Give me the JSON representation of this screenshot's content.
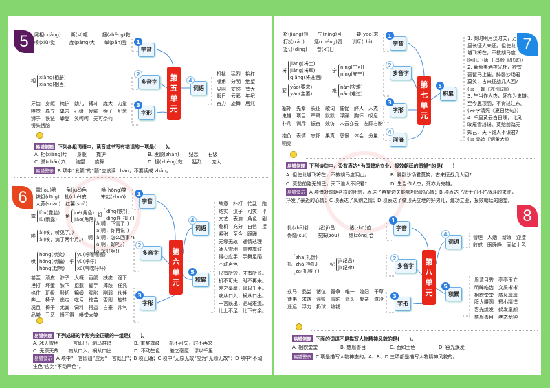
{
  "branches": {
    "ziyin": "字音",
    "duoyin": "多音字",
    "zixing": "字形",
    "ciyu": "词语",
    "jilei": "积累"
  },
  "nums": [
    "1",
    "2",
    "3",
    "4",
    "5"
  ],
  "quiz_labels": {
    "question": "易错例题",
    "answer": "易错警示"
  },
  "colors": {
    "unit5": "#5b1a5e",
    "unit6": "#e8461e",
    "unit7": "#1e8ae6",
    "unit8": "#e8304e",
    "center": "#e8271a",
    "background": "#86d66f"
  },
  "unit5": {
    "badge": "5",
    "center": [
      "第",
      "五",
      "单",
      "元"
    ],
    "ziyin": [
      "照相(xiàng)　　嘶(sī)哑　　　拯(zhěng)救",
      "嗅(xiù)觉　　　庞(páng)大　　攀(pān)登"
    ],
    "duoyin": [
      {
        "char": "相",
        "items": [
          "xiàng(相册)",
          "xiāng(相当)"
        ]
      }
    ],
    "zixing": [
      "牙齿　身躯　掩护　幼儿　搏斗　庞大　力量",
      "嗅觉　矗立　巢穴　石级　发颤　猴子　纪念",
      "狮子　铁链　攀登　笑呵呵　无可奈何",
      "愣头愣脑"
    ],
    "ciyu": [
      "打扰　猛烈　抬杠",
      "嘴角　分明　绝望",
      "尖叫　安然　夸大",
      "假日　云彩　年纪",
      "奋力　旋舞　居然"
    ],
    "quiz": {
      "question": "下列各组词语中，读音或书写有错误的一项是(　　)。",
      "options": [
        "A. 相(xiàng)片　　身躯　　掩护",
        "B. 发颤(zhàn)　　纪念　　石级",
        "C. 巢(cháo)穴　　绝望　　旋舞",
        "D. 拯(zhěng)救　　猛烈　　庞大"
      ],
      "answer": "B 项中“发颤”的“颤”应该读 chàn，不要读成 zhàn。"
    }
  },
  "unit6": {
    "badge": "6",
    "center": [
      "第",
      "六",
      "单",
      "元"
    ],
    "ziyin": [
      "露(lòu)脸　　角(jué)色　　　哄(hōng)笑",
      "铁钉(dīng)　扯(chě)皮　　　笨拙(zhuō)",
      "大蒜(suàn)　红薯(shǔ)"
    ],
    "duoyin": [
      {
        "char": "露",
        "items": [
          "lòu(露脸)",
          "lù(雨露)"
        ]
      },
      {
        "char": "角",
        "items": [
          "jué(角色)",
          "jiǎo(角落)"
        ]
      },
      {
        "char": "钉",
        "items": [
          "dīng(铁钉)",
          "dìng(钉扣子)"
        ]
      },
      {
        "char": "唉",
        "items": [
          "āi(唉，听见了。)",
          "ài(唉，病了两个月。)"
        ]
      },
      {
        "char": "啊",
        "items": [
          "ā(啊，下雪了!)",
          "á(啊，你再说!)",
          "ǎ(啊，怎么回事?)",
          "à(啊，好吧。)",
          "a(您好啊!)"
        ]
      },
      {
        "char": "哄",
        "items": [
          "hōng(哄笑)",
          "hǒng(哄骗)",
          "hòng(起哄)"
        ]
      },
      {
        "char": "吁",
        "items": [
          "yū(吁喔喔喔)",
          "yù(呼吁)",
          "xū(气喘吁吁)"
        ]
      }
    ],
    "zixing": [
      "甚至　顽皮　脖子　大概　香肠　扶携　跪下",
      "捶打　坏蛋　膝下　招惹　握手　摔跤　任凭",
      "掐住　班级　殷切　锦缎　膨胀　削弱　伙伴",
      "奔上　椅子　逃走　吃亏　挖苦　否则　旋转",
      "况且　椅子　尤其　饲料　得益　自豪　帅气",
      "品尝　丑恶　恨不得　哄堂大笑"
    ],
    "ciyu": [
      "故意　扑打　忙乱　跑",
      "结实　汉子　可笑　平",
      "文艺　表演　角色　剧",
      "危机　充分　自信　接",
      "紧张　至今　蹒跚",
      "无缘无故　通情达理",
      "冰天雪地　重整旗鼓",
      "得心应手　手舞足蹈",
      "不动声色"
    ],
    "jilei": [
      "尺有所短，寸有所长。",
      "机不可失，时不再来。",
      "差之毫厘，谬以千里。",
      "病从口入，祸从口出。",
      "一言既出，驷马难追。",
      "比上不足，比下有余。"
    ],
    "quiz": {
      "question": "下列成语的字形完全正确的一组是(　　)。",
      "options": [
        "A. 冰天雪地　　一言即出，驷马难追",
        "B. 重整旗鼓　　机不可失，时不再来",
        "C. 无原无故　　病从口入，祸从口出",
        "D. 不动生色　　差之毫厘，谬以千里"
      ],
      "answer": "A 项中“一言即出”应为“一言既出”；B 项正确；C 项中“无原无故”应为“无缘无故”；D 项中“不动生色”应为“不动声色”。"
    }
  },
  "unit7": {
    "badge": "7",
    "center": [
      "第",
      "七",
      "单",
      "元"
    ],
    "ziyin": [
      "将(jiàng)领　　宁(nìng)可　　　要(yāo)求",
      "打扰(rǎo)　　惩(chéng)罚　　训斥(chì)",
      "签订(dìng)　　昔(xī)日"
    ],
    "duoyin": [
      {
        "char": "将",
        "items": [
          "jiàng(将士)",
          "jiāng(将军)",
          "qiāng(将进酒)"
        ]
      },
      {
        "char": "宁",
        "items": [
          "nìng(宁可)",
          "níng(安宁)"
        ]
      },
      {
        "char": "要",
        "items": [
          "yāo(要求)",
          "yào(主要)"
        ]
      },
      {
        "char": "难",
        "items": [
          "nàn(灾难)",
          "nán(难过)"
        ]
      }
    ],
    "zixing": [
      "塞外　先秦　长征　歌词　催促　醉人　人杰",
      "鬼雄　项目　严肃　默默　浮躁　胸怀　叹息",
      "非凡　训斥　振奋　效仿　人云亦云　左顾右盼"
    ],
    "ciyu": [
      "抱负　表情　忘怀　果真　怨恨　体会　分量",
      "响亮"
    ],
    "jilei": [
      "1. 秦时明月汉时关，万",
      "里长征人未还。但使龙",
      "城飞将在，不教胡马度",
      "阴山。(唐·王昌龄《出塞》)",
      "2. 葡萄美酒夜光杯，欲饮",
      "琵琶马上催。醉卧沙场君",
      "莫笑，古来征战几人回?",
      "(唐·王翰《凉州词》)",
      "3. 生当作人杰，死亦为鬼雄。",
      "至今思项羽，不肯过江东。",
      "(宋·李清照《夏日绝句》)",
      "4. 千里黄云白日曛，北风",
      "吹雁雪纷纷。莫愁前路无",
      "知己，天下谁人不识君?",
      "(唐·高适《别董大》)"
    ],
    "quiz": {
      "question": "下列诗句中，没有表达“为国建功立业，报效朝廷的愿望”的是(　　)",
      "options": [
        "A. 但使龙城飞将在，不教胡马度阴山。",
        "B. 醉卧沙场君莫笑，古来征战几人回?",
        "C. 莫愁前路无知己，天下谁人不识君?",
        "D. 生当作人杰，死亦为鬼雄。"
      ],
      "answer": "A 项借对前朝名将的怀念，表达了希望边关能够巩固的心情；B 项表达了战士们不怕战斗的来临，抒发了豪迈的心情；C 项表达了离别之情；D 项表达了做顶天立地的好男儿，建功立业，报效朝廷的愿望。"
    }
  },
  "unit8": {
    "badge": "8",
    "center": [
      "第",
      "八",
      "单",
      "元"
    ],
    "ziyin": [
      "扎(zhā)针　　纪(jǐ)昌　　　诸(zhū)位",
      "骨髓(suǐ)　　挨揍(zòu)　　综(zōng)合"
    ],
    "duoyin": [
      {
        "char": "扎",
        "items": [
          "zhā(扎针)",
          "zhá(挣扎)",
          "zā(扎辫子)"
        ]
      },
      {
        "char": "纪",
        "items": [
          "jǐ(纪昌)",
          "jì(纪律)"
        ]
      }
    ],
    "zixing": [
      "戎马　品尝　诸位　竞争　唯一　媳妇　干草",
      "徒弟　求饶　混账　雪豹　派头　娶亲　淹没",
      "遥远　浮力　扔球　编钱"
    ],
    "ciyu": [
      "管理　人烟　新娘　迎接",
      "收成　眼睁睁　面如土色"
    ],
    "jilei": [
      "眉清目秀　亭亭玉立",
      "明眸皓齿　文质彬彬",
      "相貌堂堂　威风凛凛",
      "膀大腰圆　短小精悍",
      "容光焕发　鹤发童颜",
      "慈眉善目　老态龙钟"
    ],
    "quiz": {
      "question": "下面的词语不是描写人物精神风貌的是(　　)。",
      "options": [
        "A. 相貌堂堂",
        "B. 慈眉善目",
        "C. 面如土色",
        "D. 容光焕发"
      ],
      "answer": "C 项是描写人物神态的，A、B、D 三项都是描写人物精神风貌的。"
    }
  }
}
